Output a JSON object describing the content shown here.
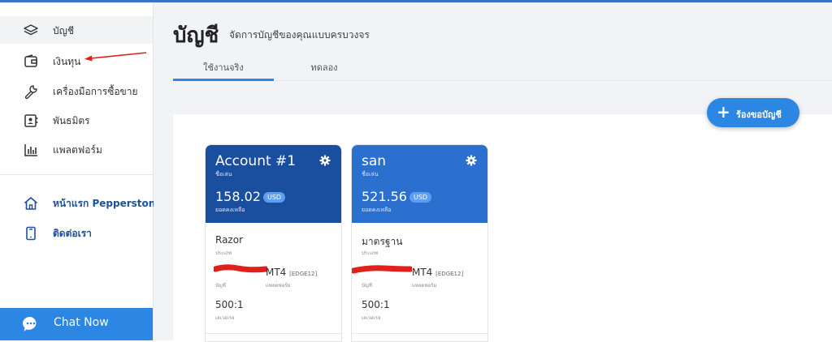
{
  "sidebar": {
    "items": [
      {
        "label": "บัญชี",
        "icon": "layers-icon"
      },
      {
        "label": "เงินทุน",
        "icon": "wallet-icon"
      },
      {
        "label": "เครื่องมือการซื้อขาย",
        "icon": "wrench-icon"
      },
      {
        "label": "พันธมิตร",
        "icon": "contact-card-icon"
      },
      {
        "label": "แพลตฟอร์ม",
        "icon": "bar-chart-icon"
      }
    ],
    "links": [
      {
        "label": "หน้าแรก Pepperstone",
        "icon": "home-icon"
      },
      {
        "label": "ติดต่อเรา",
        "icon": "phone-icon"
      }
    ],
    "chat_label": "Chat Now"
  },
  "header": {
    "title": "บัญชี",
    "subtitle": "จัดการบัญชีของคุณแบบครบวงจร"
  },
  "tabs": [
    {
      "label": "ใช้งานจริง",
      "active": true
    },
    {
      "label": "ทดลอง",
      "active": false
    }
  ],
  "request_button_label": "ร้องขอบัญชี",
  "accounts": [
    {
      "name": "Account #1",
      "name_label": "ชื่อเล่น",
      "balance": "158.02",
      "currency": "USD",
      "balance_label": "ยอดคงเหลือ",
      "type": "Razor",
      "type_label": "ประเภท",
      "platform": "MT4",
      "server": "[EDGE12]",
      "account_label": "บัญชี",
      "platform_label": "แพลตฟอร์ม",
      "leverage": "500:1",
      "leverage_label": "เลเวอเรจ",
      "header_color": "#1a4fa0"
    },
    {
      "name": "san",
      "name_label": "ชื่อเล่น",
      "balance": "521.56",
      "currency": "USD",
      "balance_label": "ยอดคงเหลือ",
      "type": "มาตรฐาน",
      "type_label": "ประเภท",
      "platform": "MT4",
      "server": "[EDGE12]",
      "account_label": "บัญชี",
      "platform_label": "แพลตฟอร์ม",
      "leverage": "500:1",
      "leverage_label": "เลเวอเรจ",
      "header_color": "#2b6fcf"
    }
  ],
  "colors": {
    "accent": "#2b87e3",
    "link": "#1f4f9c",
    "annotation_red": "#e0201b"
  }
}
